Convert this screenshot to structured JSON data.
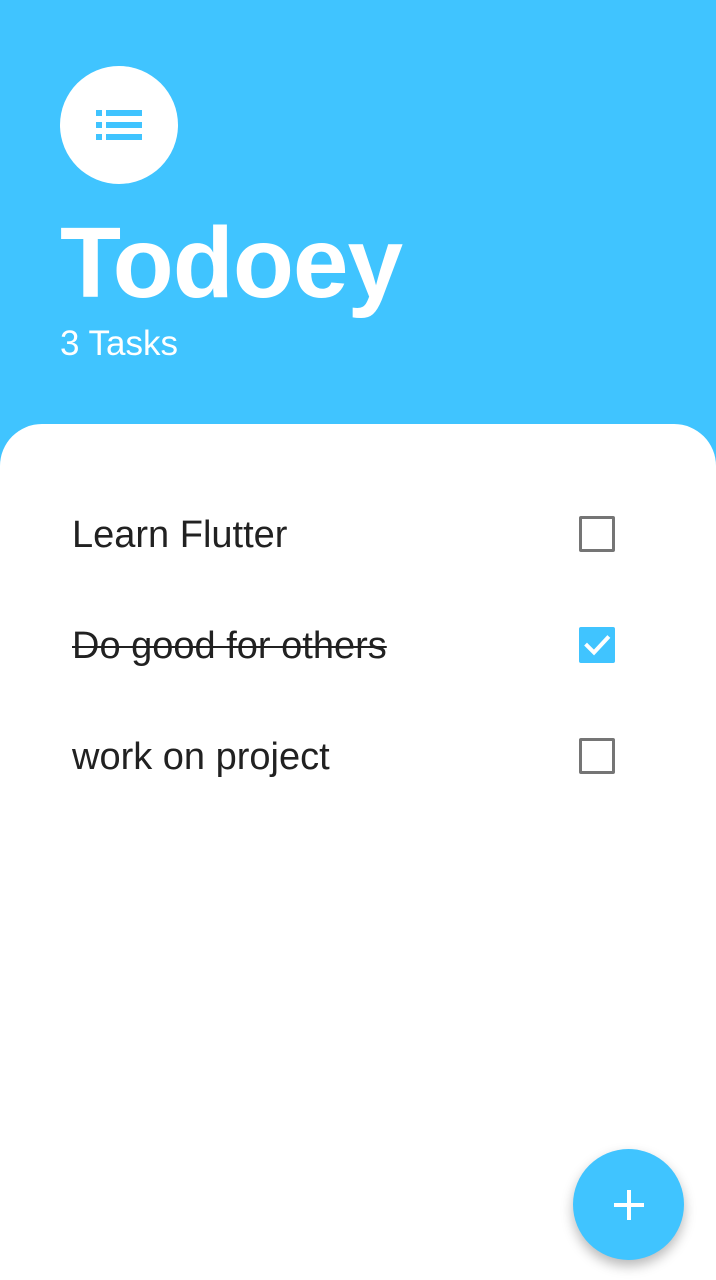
{
  "header": {
    "menu_icon": "list-icon",
    "title": "Todoey",
    "task_count": "3 Tasks"
  },
  "tasks": [
    {
      "label": "Learn Flutter",
      "done": false
    },
    {
      "label": "Do good for others",
      "done": true
    },
    {
      "label": "work on project",
      "done": false
    }
  ],
  "fab": {
    "icon": "plus-icon"
  },
  "colors": {
    "accent": "#40C4FF",
    "text": "#212121",
    "checkbox_border": "#757575",
    "background": "#FFFFFF"
  }
}
